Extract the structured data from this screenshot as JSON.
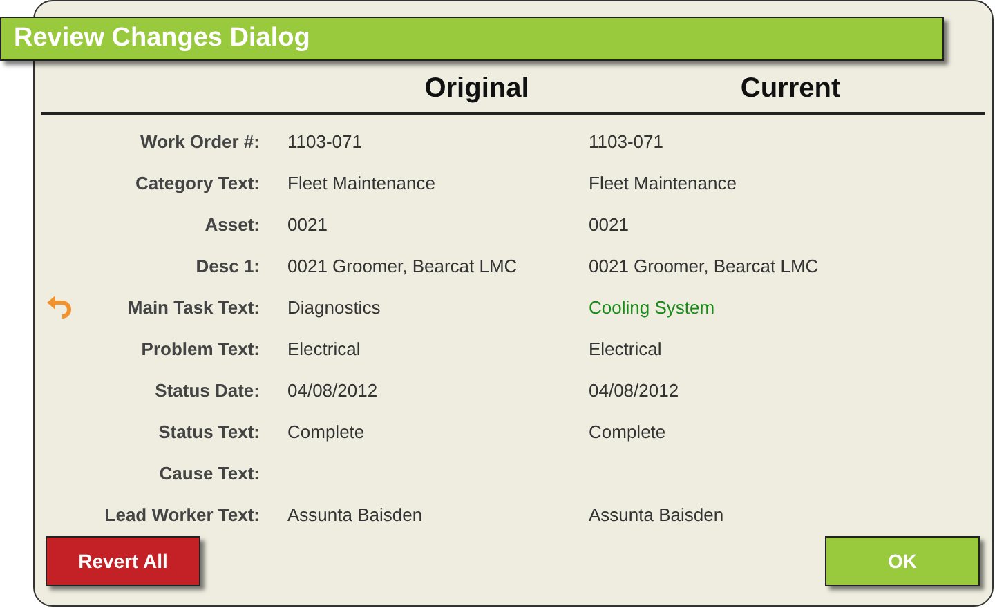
{
  "title": "Review Changes Dialog",
  "columns": [
    "Original",
    "Current"
  ],
  "rows": [
    {
      "label": "Work Order #:",
      "original": "1103-071",
      "current": "1103-071",
      "changed": false
    },
    {
      "label": "Category Text:",
      "original": "Fleet Maintenance",
      "current": "Fleet Maintenance",
      "changed": false
    },
    {
      "label": "Asset:",
      "original": "0021",
      "current": "0021",
      "changed": false
    },
    {
      "label": "Desc 1:",
      "original": "0021 Groomer, Bearcat LMC",
      "current": "0021 Groomer, Bearcat LMC",
      "changed": false
    },
    {
      "label": "Main Task Text:",
      "original": "Diagnostics",
      "current": "Cooling System",
      "changed": true
    },
    {
      "label": "Problem Text:",
      "original": "Electrical",
      "current": "Electrical",
      "changed": false
    },
    {
      "label": "Status Date:",
      "original": "04/08/2012",
      "current": "04/08/2012",
      "changed": false
    },
    {
      "label": "Status Text:",
      "original": "Complete",
      "current": "Complete",
      "changed": false
    },
    {
      "label": "Cause Text:",
      "changed": false
    },
    {
      "label": "Lead Worker Text:",
      "original": "Assunta Baisden",
      "current": "Assunta Baisden",
      "changed": false
    }
  ],
  "buttons": [
    {
      "label": "Revert All",
      "kind": "danger"
    },
    {
      "label": "OK",
      "kind": "primary"
    }
  ]
}
